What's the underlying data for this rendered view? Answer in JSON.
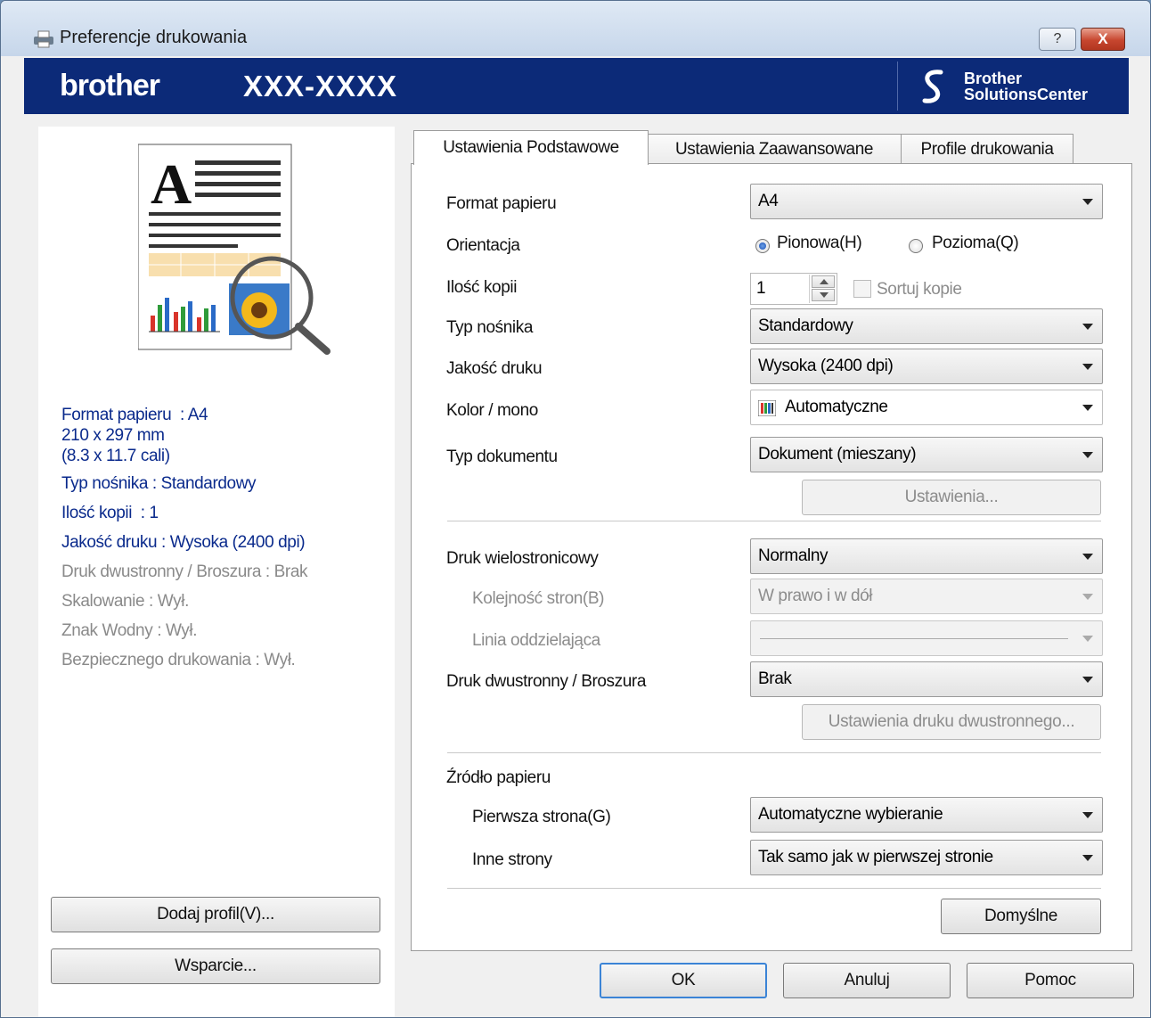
{
  "window": {
    "title": "Preferencje drukowania",
    "help_glyph": "?",
    "close_glyph": "X"
  },
  "banner": {
    "logo": "brother",
    "model": "XXX-XXXX",
    "solutions_line1": "Brother",
    "solutions_line2": "SolutionsCenter",
    "background": "#0c2a78"
  },
  "summary": [
    {
      "text": "Format papieru  : A4",
      "state": "active"
    },
    {
      "text": "210 x 297 mm",
      "state": "active"
    },
    {
      "text": "(8.3 x 11.7 cali)",
      "state": "active"
    },
    {
      "text": "Typ nośnika : Standardowy",
      "state": "active"
    },
    {
      "text": "Ilość kopii  : 1",
      "state": "active"
    },
    {
      "text": "Jakość druku : Wysoka (2400 dpi)",
      "state": "active"
    },
    {
      "text": "Druk dwustronny / Broszura : Brak",
      "state": "inactive"
    },
    {
      "text": "Skalowanie : Wył.",
      "state": "inactive"
    },
    {
      "text": "Znak Wodny : Wył.",
      "state": "inactive"
    },
    {
      "text": "Bezpiecznego drukowania : Wył.",
      "state": "inactive"
    }
  ],
  "left_buttons": {
    "add_profile": "Dodaj profil(V)...",
    "support": "Wsparcie..."
  },
  "tabs": [
    {
      "label": "Ustawienia Podstawowe",
      "active": true
    },
    {
      "label": "Ustawienia Zaawansowane",
      "active": false
    },
    {
      "label": "Profile drukowania",
      "active": false
    }
  ],
  "form": {
    "paper_size": {
      "label": "Format papieru",
      "value": "A4"
    },
    "orientation": {
      "label": "Orientacja",
      "portrait": "Pionowa(H)",
      "landscape": "Pozioma(Q)",
      "selected": "portrait"
    },
    "copies": {
      "label": "Ilość kopii",
      "value": "1",
      "collate_label": "Sortuj kopie",
      "collate_checked": false
    },
    "media_type": {
      "label": "Typ nośnika",
      "value": "Standardowy"
    },
    "print_quality": {
      "label": "Jakość druku",
      "value": "Wysoka (2400 dpi)"
    },
    "color_mono": {
      "label": "Kolor / mono",
      "value": "Automatyczne"
    },
    "document_type": {
      "label": "Typ dokumentu",
      "value": "Dokument (mieszany)"
    },
    "settings_button": "Ustawienia...",
    "multiple_page": {
      "label": "Druk wielostronicowy",
      "value": "Normalny"
    },
    "page_order": {
      "label": "Kolejność stron(B)",
      "value": "W prawo i w dół"
    },
    "border_line": {
      "label": "Linia oddzielająca",
      "value": ""
    },
    "duplex": {
      "label": "Druk dwustronny / Broszura",
      "value": "Brak"
    },
    "duplex_settings_button": "Ustawienia druku dwustronnego...",
    "paper_source": {
      "label": "Źródło papieru"
    },
    "first_page": {
      "label": "Pierwsza strona(G)",
      "value": "Automatyczne wybieranie"
    },
    "other_pages": {
      "label": "Inne strony",
      "value": "Tak samo jak w pierwszej stronie"
    },
    "default_button": "Domyślne"
  },
  "footer": {
    "ok": "OK",
    "cancel": "Anuluj",
    "help": "Pomoc"
  }
}
